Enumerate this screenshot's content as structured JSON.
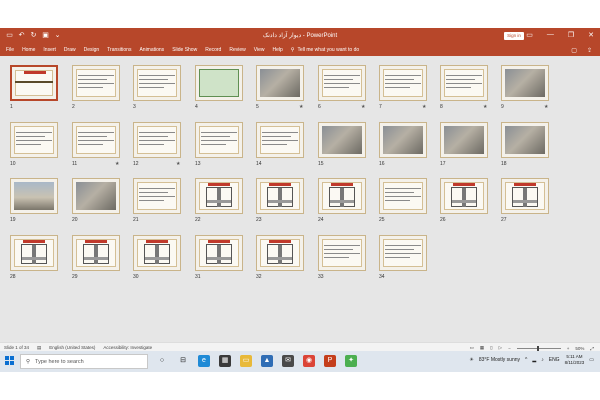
{
  "window": {
    "document_title": "دیوار آزاد دادنک - PowerPoint",
    "signin_label": "Sign in",
    "controls": [
      "—",
      "❐",
      "✕"
    ]
  },
  "ribbon": {
    "tabs": [
      "File",
      "Home",
      "Insert",
      "Draw",
      "Design",
      "Transitions",
      "Animations",
      "Slide Show",
      "Record",
      "Review",
      "View",
      "Help"
    ],
    "tell_me": "Tell me what you want to do"
  },
  "slides": [
    {
      "n": "1",
      "star": ""
    },
    {
      "n": "2",
      "star": ""
    },
    {
      "n": "3",
      "star": ""
    },
    {
      "n": "4",
      "star": ""
    },
    {
      "n": "5",
      "star": "★"
    },
    {
      "n": "6",
      "star": "★"
    },
    {
      "n": "7",
      "star": "★"
    },
    {
      "n": "8",
      "star": "★"
    },
    {
      "n": "9",
      "star": "★"
    },
    {
      "n": "10",
      "star": ""
    },
    {
      "n": "11",
      "star": "★"
    },
    {
      "n": "12",
      "star": "★"
    },
    {
      "n": "13",
      "star": ""
    },
    {
      "n": "14",
      "star": ""
    },
    {
      "n": "15",
      "star": ""
    },
    {
      "n": "16",
      "star": ""
    },
    {
      "n": "17",
      "star": ""
    },
    {
      "n": "18",
      "star": ""
    },
    {
      "n": "19",
      "star": ""
    },
    {
      "n": "20",
      "star": ""
    },
    {
      "n": "21",
      "star": ""
    },
    {
      "n": "22",
      "star": ""
    },
    {
      "n": "23",
      "star": ""
    },
    {
      "n": "24",
      "star": ""
    },
    {
      "n": "25",
      "star": ""
    },
    {
      "n": "26",
      "star": ""
    },
    {
      "n": "27",
      "star": ""
    },
    {
      "n": "28",
      "star": ""
    },
    {
      "n": "29",
      "star": ""
    },
    {
      "n": "30",
      "star": ""
    },
    {
      "n": "31",
      "star": ""
    },
    {
      "n": "32",
      "star": ""
    },
    {
      "n": "33",
      "star": ""
    },
    {
      "n": "34",
      "star": ""
    }
  ],
  "status": {
    "slide_info": "Slide 1 of 34",
    "language": "English (United States)",
    "accessibility": "Accessibility: Investigate",
    "zoom": "50%"
  },
  "taskbar": {
    "search_placeholder": "Type here to search",
    "weather": "83°F  Mostly sunny",
    "lang": "ENG",
    "time": "5:11 AM",
    "date": "8/11/2023"
  }
}
